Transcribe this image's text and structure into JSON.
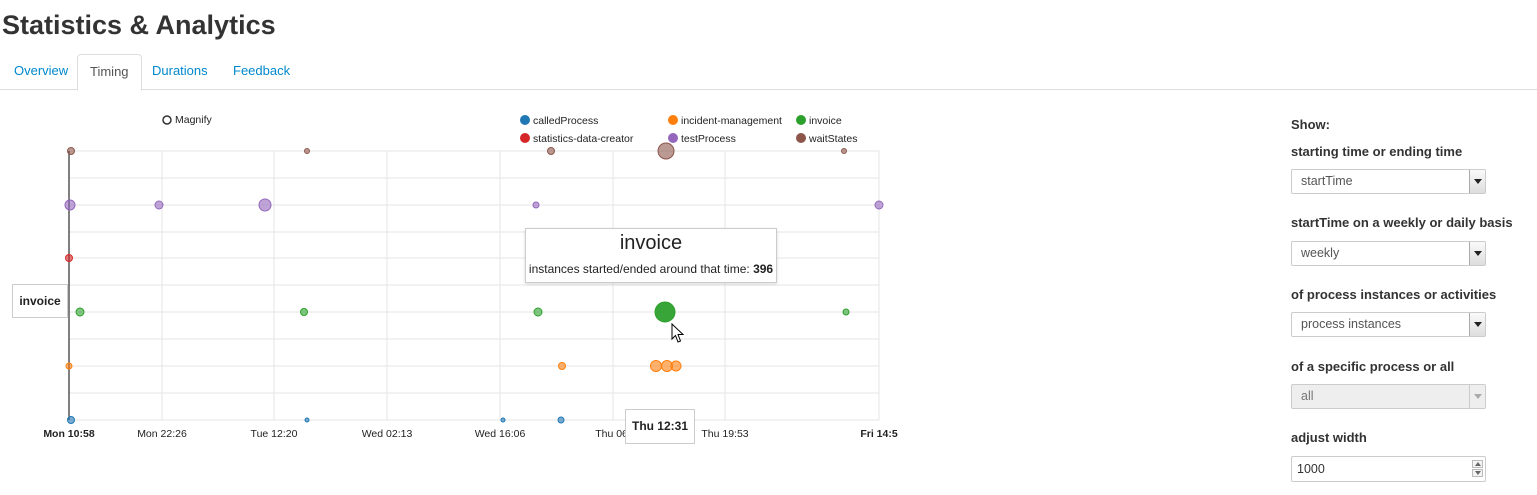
{
  "page_title": "Statistics & Analytics",
  "tabs": [
    {
      "label": "Overview",
      "active": false
    },
    {
      "label": "Timing",
      "active": true
    },
    {
      "label": "Durations",
      "active": false
    },
    {
      "label": "Feedback",
      "active": false
    }
  ],
  "magnify_label": "Magnify",
  "chart_data": {
    "type": "scatter",
    "title": "",
    "series": [
      {
        "name": "calledProcess",
        "color": "#1f77b4"
      },
      {
        "name": "statistics-data-creator",
        "color": "#d62728"
      },
      {
        "name": "incident-management",
        "color": "#ff7f0e"
      },
      {
        "name": "testProcess",
        "color": "#9467bd"
      },
      {
        "name": "invoice",
        "color": "#2ca02c"
      },
      {
        "name": "waitStates",
        "color": "#8c564b"
      }
    ],
    "rows": [
      "waitStates",
      "testProcess",
      "statistics-data-creator",
      "invoice",
      "incident-management",
      "calledProcess"
    ],
    "x_ticks": [
      {
        "label": "Mon 10:58",
        "bold": true
      },
      {
        "label": "Mon 22:26",
        "bold": false
      },
      {
        "label": "Tue 12:20",
        "bold": false
      },
      {
        "label": "Wed 02:13",
        "bold": false
      },
      {
        "label": "Wed 16:06",
        "bold": false
      },
      {
        "label": "Thu 06:",
        "bold": false
      },
      {
        "label": "Thu 19:53",
        "bold": false
      },
      {
        "label": "Fri 14:5",
        "bold": true
      }
    ],
    "legend_position": "top-right",
    "grid": true
  },
  "tooltip": {
    "title": "invoice",
    "body_prefix": "instances started/ended around that time:",
    "count": "396"
  },
  "hover_labels": {
    "y": "invoice",
    "x": "Thu 12:31"
  },
  "controls": {
    "heading": "Show:",
    "time_label": "starting time or ending time",
    "time_value": "startTime",
    "basis_label": "startTime on a weekly or daily basis",
    "basis_value": "weekly",
    "type_label": "of process instances or activities",
    "type_value": "process instances",
    "process_label": "of a specific process or all",
    "process_value": "all",
    "width_label": "adjust width",
    "width_value": "1000"
  }
}
